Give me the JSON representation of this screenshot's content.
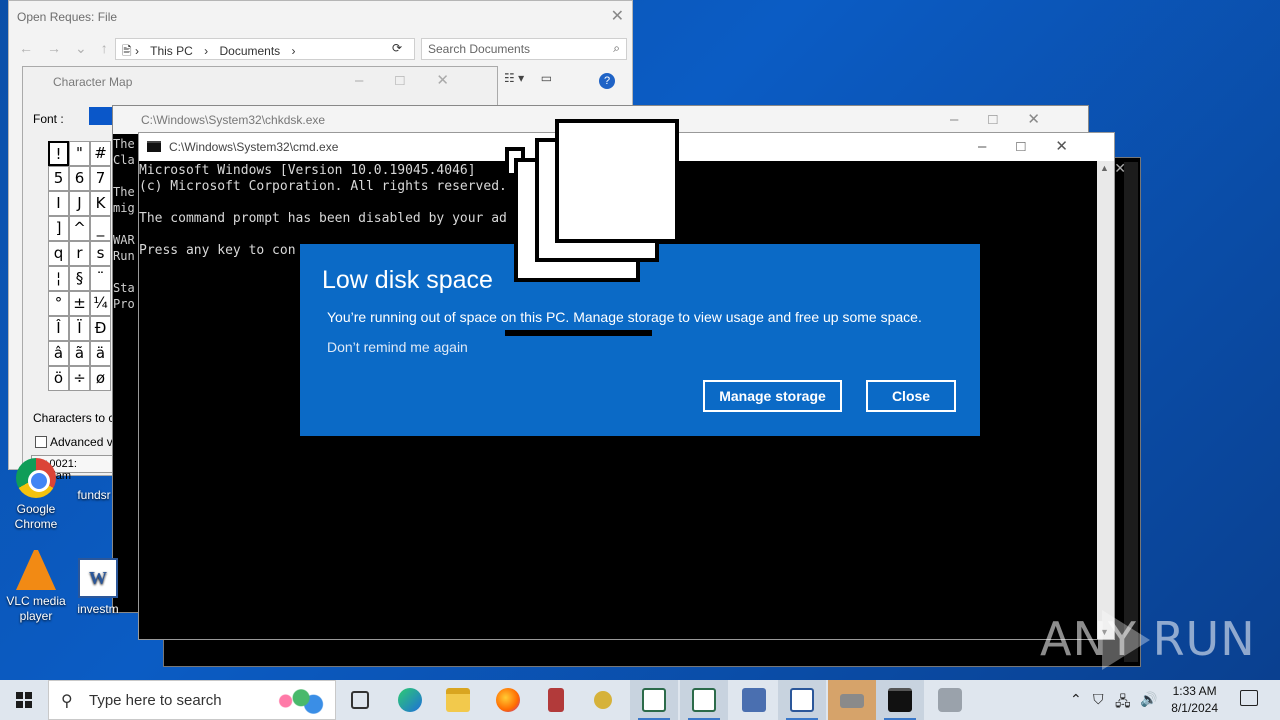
{
  "explorer": {
    "title": "Open Reques: File",
    "breadcrumb": [
      "This PC",
      "Documents"
    ],
    "search_placeholder": "Search Documents"
  },
  "charmap": {
    "title": "Character Map",
    "font_label": "Font :",
    "chars": [
      "!",
      "\"",
      "#",
      "5",
      "6",
      "7",
      "I",
      "J",
      "K",
      "]",
      "^",
      "_",
      "q",
      "r",
      "s",
      "¦",
      "§",
      "¨",
      "°",
      "±",
      "¼",
      "Î",
      "Ï",
      "Ð",
      "â",
      "ã",
      "ä",
      "ö",
      "÷",
      "ø"
    ],
    "copy_label": "Characters to co",
    "advanced_label": "Advanced vie",
    "status": "U+0021: Exclam"
  },
  "chkdsk": {
    "title": "C:\\Windows\\System32\\chkdsk.exe",
    "lines": [
      "The",
      "Cla",
      "",
      "The",
      "mig",
      "",
      "WAR",
      "Run",
      "",
      "Sta",
      "Pro"
    ]
  },
  "cmd": {
    "title": "C:\\Windows\\System32\\cmd.exe",
    "lines": [
      "Microsoft Windows [Version 10.0.19045.4046]",
      "(c) Microsoft Corporation. All rights reserved.",
      "",
      "The command prompt has been disabled by your ad",
      "",
      "Press any key to con"
    ]
  },
  "toast": {
    "heading": "Low disk space",
    "message": "You’re running out of space on this PC. Manage storage to view usage and free up some space.",
    "dont_remind": "Don’t remind me again",
    "manage_button": "Manage storage",
    "close_button": "Close"
  },
  "desktop": {
    "icons": [
      {
        "label": "Google Chrome",
        "icon": "chrome-icon"
      },
      {
        "label": "fundsr",
        "icon": "file-icon"
      },
      {
        "label": "VLC media player",
        "icon": "vlc-icon"
      },
      {
        "label": "investm",
        "icon": "word-icon"
      }
    ]
  },
  "watermark": "ANY RUN",
  "taskbar": {
    "search_placeholder": "Type here to search",
    "time": "1:33 AM",
    "date": "8/1/2024"
  }
}
